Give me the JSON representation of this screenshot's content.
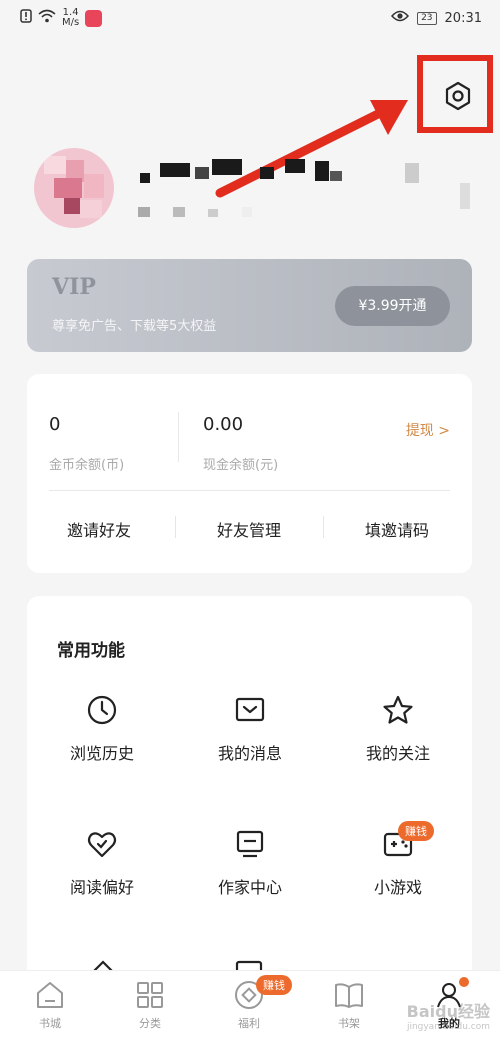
{
  "status_bar": {
    "speed_value": "1.4",
    "speed_unit": "M/s",
    "battery": "23",
    "time": "20:31"
  },
  "vip": {
    "title": "VIP",
    "description": "尊享免广告、下载等5大权益",
    "button": "¥3.99开通"
  },
  "wallet": {
    "coins_value": "0",
    "coins_label": "金币余额(币)",
    "cash_value": "0.00",
    "cash_label": "现金余额(元)",
    "withdraw": "提现 >",
    "links": [
      "邀请好友",
      "好友管理",
      "填邀请码"
    ]
  },
  "features": {
    "title": "常用功能",
    "items": [
      {
        "label": "浏览历史",
        "icon": "clock-icon"
      },
      {
        "label": "我的消息",
        "icon": "message-icon"
      },
      {
        "label": "我的关注",
        "icon": "star-icon"
      },
      {
        "label": "阅读偏好",
        "icon": "heart-icon"
      },
      {
        "label": "作家中心",
        "icon": "monitor-icon"
      },
      {
        "label": "小游戏",
        "icon": "gamepad-icon",
        "badge": "赚钱"
      }
    ]
  },
  "tabbar": {
    "tabs": [
      {
        "label": "书城",
        "icon": "home-icon"
      },
      {
        "label": "分类",
        "icon": "grid-icon"
      },
      {
        "label": "福利",
        "icon": "coin-icon",
        "badge": "赚钱"
      },
      {
        "label": "书架",
        "icon": "book-icon"
      },
      {
        "label": "我的",
        "icon": "profile-icon",
        "active": true
      }
    ]
  },
  "watermark": {
    "text": "Baidu经验",
    "sub": "jingyan.baidu.com"
  },
  "colors": {
    "annotation": "#e12c1e",
    "accent": "#ec6a2c",
    "withdraw": "#d18a4a"
  }
}
